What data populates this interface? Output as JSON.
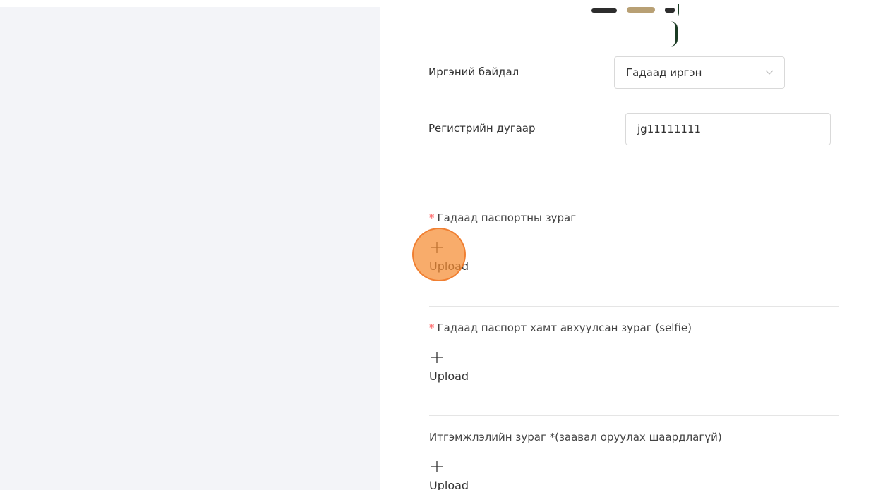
{
  "form": {
    "citizenship_label": "Иргэний байдал",
    "citizenship_value": "Гадаад иргэн",
    "register_label": "Регистрийн дугаар",
    "register_value": "jg11111111"
  },
  "uploads": {
    "required_mark": "*",
    "upload_label": "Upload",
    "passport_title": "Гадаад паспортны зураг",
    "selfie_title": "Гадаад паспорт хамт авхуулсан зураг (selfie)",
    "certificate_title": "Итгэмжлэлийн зураг *(заавал оруулах шаардлагүй)"
  },
  "colors": {
    "required": "#ff4d4f",
    "cursor_highlight": "#f58c32",
    "border": "#d9d9d9"
  },
  "icons": {
    "select_arrow": "chevron-down-icon",
    "upload": "plus-icon"
  }
}
